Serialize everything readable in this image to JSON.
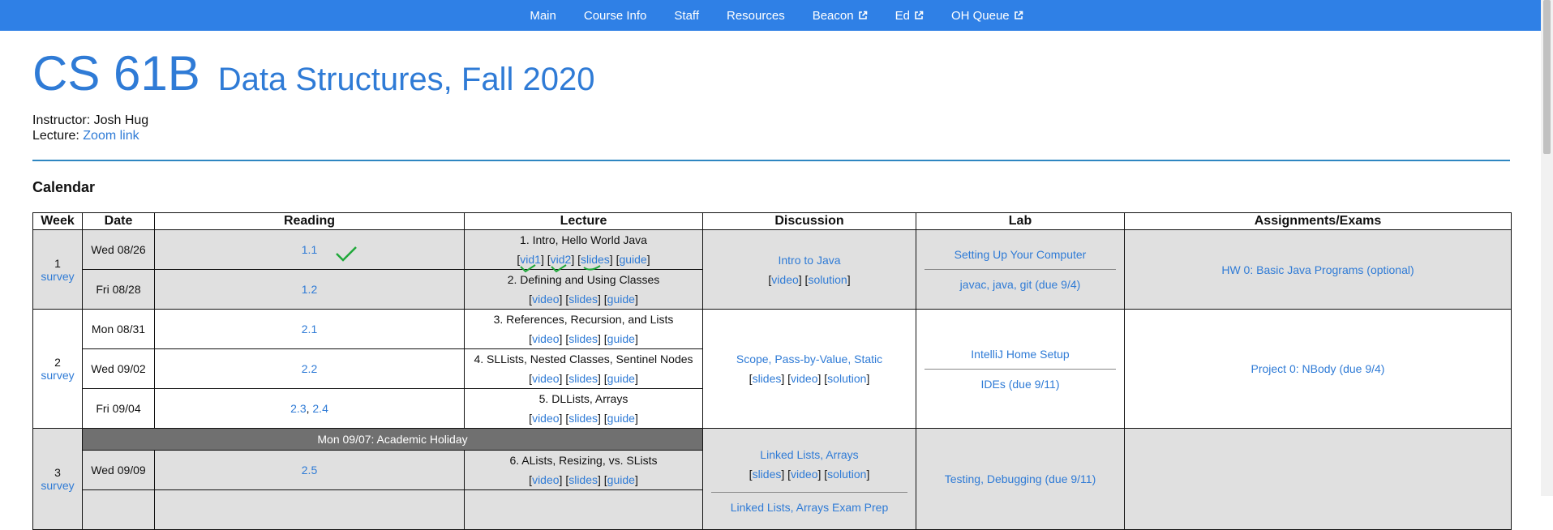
{
  "nav": {
    "items": [
      {
        "label": "Main",
        "external": false
      },
      {
        "label": "Course Info",
        "external": false
      },
      {
        "label": "Staff",
        "external": false
      },
      {
        "label": "Resources",
        "external": false
      },
      {
        "label": "Beacon",
        "external": true
      },
      {
        "label": "Ed",
        "external": true
      },
      {
        "label": "OH Queue",
        "external": true
      }
    ],
    "bg_color": "#2f80e6"
  },
  "header": {
    "code": "CS 61B",
    "name": "Data Structures, Fall 2020",
    "instructor_label": "Instructor:",
    "instructor": "Josh Hug",
    "lecture_label": "Lecture:",
    "lecture_link": "Zoom link"
  },
  "calendar": {
    "heading": "Calendar",
    "columns": [
      "Week",
      "Date",
      "Reading",
      "Lecture",
      "Discussion",
      "Lab",
      "Assignments/Exams"
    ],
    "weeks": [
      {
        "week": "1",
        "survey": "survey",
        "days": [
          {
            "date": "Wed 08/26",
            "reading": [
              "1.1"
            ],
            "lecture": "1. Intro, Hello World Java",
            "links": [
              "vid1",
              "vid2",
              "slides",
              "guide"
            ]
          },
          {
            "date": "Fri 08/28",
            "reading": [
              "1.2"
            ],
            "lecture": "2. Defining and Using Classes",
            "links": [
              "video",
              "slides",
              "guide"
            ]
          }
        ],
        "discussion": {
          "title": "Intro to Java",
          "links": [
            "video",
            "solution"
          ]
        },
        "lab": [
          "Setting Up Your Computer",
          "javac, java, git (due 9/4)"
        ],
        "assignment": "HW 0: Basic Java Programs (optional)"
      },
      {
        "week": "2",
        "survey": "survey",
        "days": [
          {
            "date": "Mon 08/31",
            "reading": [
              "2.1"
            ],
            "lecture": "3. References, Recursion, and Lists",
            "links": [
              "video",
              "slides",
              "guide"
            ]
          },
          {
            "date": "Wed 09/02",
            "reading": [
              "2.2"
            ],
            "lecture": "4. SLLists, Nested Classes, Sentinel Nodes",
            "links": [
              "video",
              "slides",
              "guide"
            ]
          },
          {
            "date": "Fri 09/04",
            "reading": [
              "2.3",
              "2.4"
            ],
            "lecture": "5. DLLists, Arrays",
            "links": [
              "video",
              "slides",
              "guide"
            ]
          }
        ],
        "discussion": {
          "title": "Scope, Pass-by-Value, Static",
          "links": [
            "slides",
            "video",
            "solution"
          ]
        },
        "lab": [
          "IntelliJ Home Setup",
          "IDEs (due 9/11)"
        ],
        "assignment": "Project 0: NBody (due 9/4)"
      },
      {
        "week": "3",
        "survey": "survey",
        "holiday": "Mon 09/07: Academic Holiday",
        "days": [
          {
            "date": "Wed 09/09",
            "reading": [
              "2.5"
            ],
            "lecture": "6. ALists, Resizing, vs. SLists",
            "links": [
              "video",
              "slides",
              "guide"
            ]
          }
        ],
        "discussion": {
          "title": "Linked Lists, Arrays",
          "links": [
            "slides",
            "video",
            "solution"
          ],
          "extra": "Linked Lists, Arrays Exam Prep"
        },
        "lab": [
          "Testing, Debugging (due 9/11)"
        ]
      }
    ]
  },
  "colors": {
    "accent": "#2f7bd6",
    "row_grey": "#e0e0e0",
    "holiday_grey": "#707070",
    "check_green": "#1fa83a"
  }
}
